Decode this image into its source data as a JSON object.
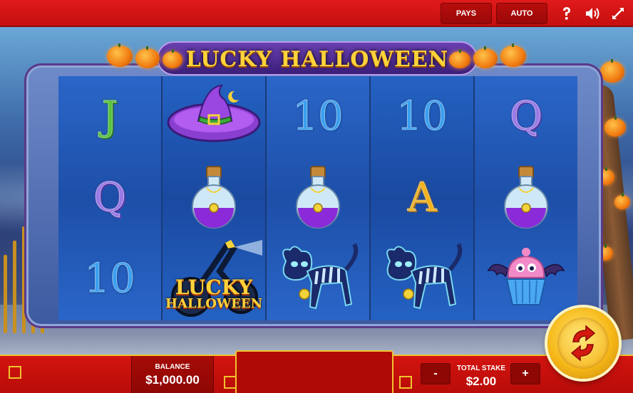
{
  "game": {
    "title": "LUCKY HALLOWEEN"
  },
  "topbar": {
    "pays_label": "PAYS",
    "auto_label": "AUTO",
    "help_icon": "question-mark-icon",
    "sound_icon": "speaker-icon",
    "fullscreen_icon": "expand-icon"
  },
  "reels": [
    [
      "J",
      "Q",
      "10"
    ],
    [
      "witch-hat",
      "potion",
      "wild-motorcycle"
    ],
    [
      "10",
      "potion",
      "skeleton-cat"
    ],
    [
      "10",
      "A",
      "skeleton-cat"
    ],
    [
      "Q",
      "potion",
      "cupcake-bat"
    ]
  ],
  "symbols": {
    "wild_text_1": "LUCKY",
    "wild_text_2": "HALLOWEEN"
  },
  "bottombar": {
    "balance_label": "BALANCE",
    "balance_value": "$1,000.00",
    "stake_label": "TOTAL STAKE",
    "stake_value": "$2.00",
    "minus_label": "-",
    "plus_label": "+"
  },
  "colors": {
    "bar_red": "#c50f0f",
    "gold": "#f1c230",
    "spin_gold": "#f6b818",
    "reel_blue": "#1d4fa8"
  }
}
